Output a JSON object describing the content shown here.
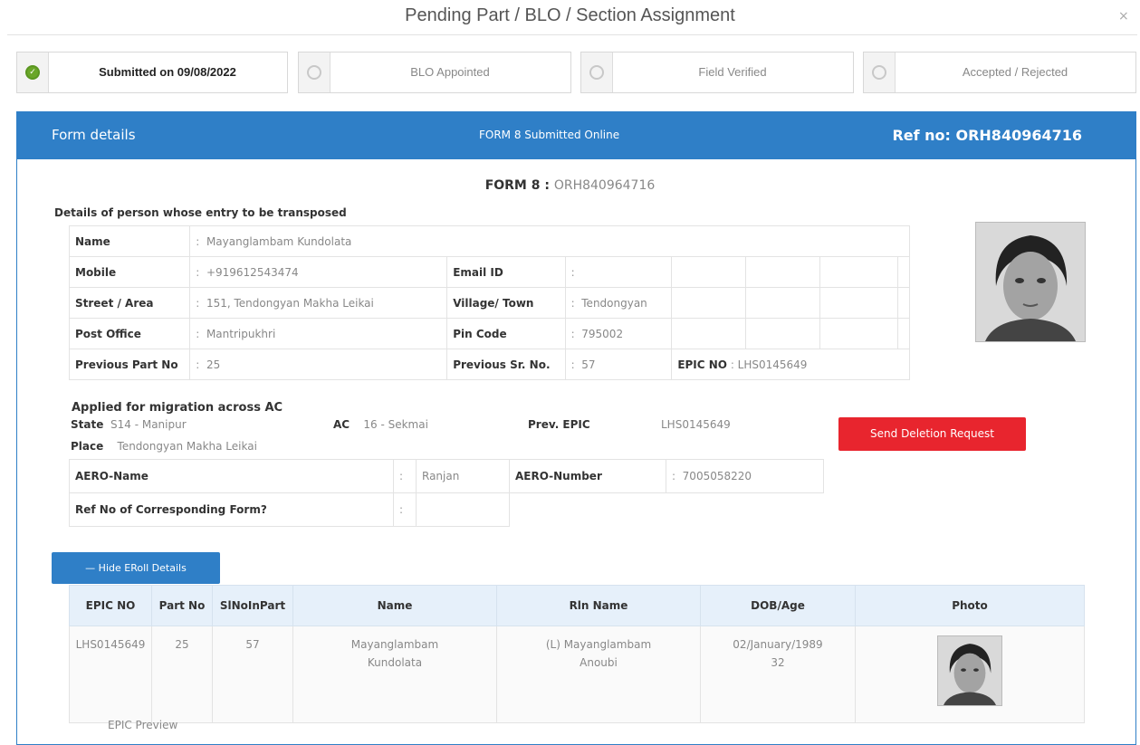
{
  "title": "Pending Part / BLO / Section Assignment",
  "close_glyph": "×",
  "steps": [
    {
      "label": "Submitted on 09/08/2022",
      "done": true
    },
    {
      "label": "BLO Appointed",
      "done": false
    },
    {
      "label": "Field Verified",
      "done": false
    },
    {
      "label": "Accepted / Rejected",
      "done": false
    }
  ],
  "panel": {
    "left": "Form details",
    "center": "FORM 8 Submitted Online",
    "right": "Ref no: ORH840964716"
  },
  "form_title": {
    "label": "FORM 8",
    "sep": " : ",
    "value": "ORH840964716"
  },
  "person": {
    "heading": "Details of person whose entry to be transposed",
    "name_k": "Name",
    "name_v": "Mayanglambam Kundolata",
    "mobile_k": "Mobile",
    "mobile_v": "+919612543474",
    "email_k": "Email ID",
    "email_v": "",
    "street_k": "Street / Area",
    "street_v": "151, Tendongyan Makha Leikai",
    "village_k": "Village/ Town",
    "village_v": "Tendongyan",
    "po_k": "Post Office",
    "po_v": "Mantripukhri",
    "pin_k": "Pin Code",
    "pin_v": "795002",
    "ppart_k": "Previous Part No",
    "ppart_v": "25",
    "psr_k": "Previous Sr. No.",
    "psr_v": "57",
    "epic_k": "EPIC NO",
    "epic_v": "LHS0145649"
  },
  "migration": {
    "heading": "Applied for migration across AC",
    "state_k": "State",
    "state_v": "S14 - Manipur",
    "ac_k": "AC",
    "ac_v": "16 - Sekmai",
    "prev_k": "Prev. EPIC",
    "prev_v": "LHS0145649",
    "place_k": "Place",
    "place_v": "Tendongyan Makha Leikai"
  },
  "aero": {
    "name_k": "AERO-Name",
    "name_v": "Ranjan",
    "num_k": "AERO-Number",
    "num_v": "7005058220",
    "ref_k": "Ref No of Corresponding Form?",
    "ref_v": ""
  },
  "buttons": {
    "deletion": "Send Deletion Request",
    "hide": "— Hide ERoll Details"
  },
  "eroll": {
    "headers": [
      "EPIC NO",
      "Part No",
      "SlNoInPart",
      "Name",
      "Rln Name",
      "DOB/Age",
      "Photo"
    ],
    "row": {
      "epic": "LHS0145649",
      "part": "25",
      "slno": "57",
      "name": "Mayanglambam Kundolata",
      "rln": "(L) Mayanglambam Anoubi",
      "dob": "02/January/1989",
      "age": "32"
    }
  },
  "epic_preview": "EPIC Preview",
  "colors": {
    "header_blue": "#2f7fc7",
    "danger": "#e8252e",
    "success": "#6aa629"
  }
}
